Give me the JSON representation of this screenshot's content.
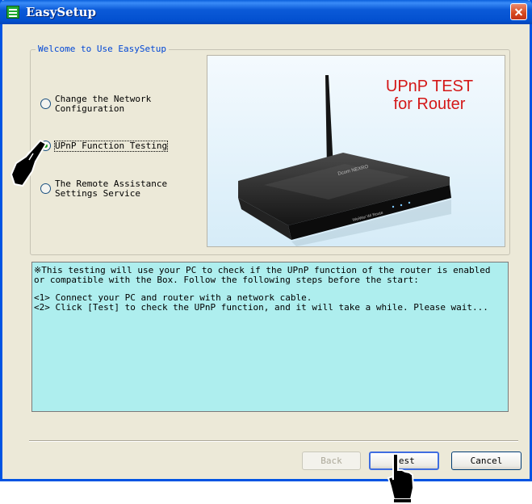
{
  "window": {
    "title": "EasySetup"
  },
  "group": {
    "label": "Welcome to Use EasySetup"
  },
  "options": [
    {
      "label": "Change the Network\nConfiguration",
      "checked": false
    },
    {
      "label": "UPnP Function Testing",
      "checked": true
    },
    {
      "label": "The Remote Assistance\nSettings Service",
      "checked": false
    }
  ],
  "image": {
    "caption": "UPnP TEST\nfor Router",
    "device_label": "WeiWei Wi Route",
    "device_brand": "Dcom NEXRO"
  },
  "info": {
    "paragraph1": "※This testing will use your PC to check if the UPnP function of the router is enabled or compatible with the Box. Follow the following steps before the start:",
    "paragraph2": "<1> Connect your PC and router with a network cable.\n<2> Click [Test] to check the UPnP function, and it will take a while. Please wait..."
  },
  "buttons": {
    "back": "Back",
    "test": "Test",
    "cancel": "Cancel"
  },
  "colors": {
    "titlebar": "#0054e3",
    "info_bg": "#aeeeee",
    "accent_red": "#d41818",
    "group_label": "#0046d5"
  }
}
